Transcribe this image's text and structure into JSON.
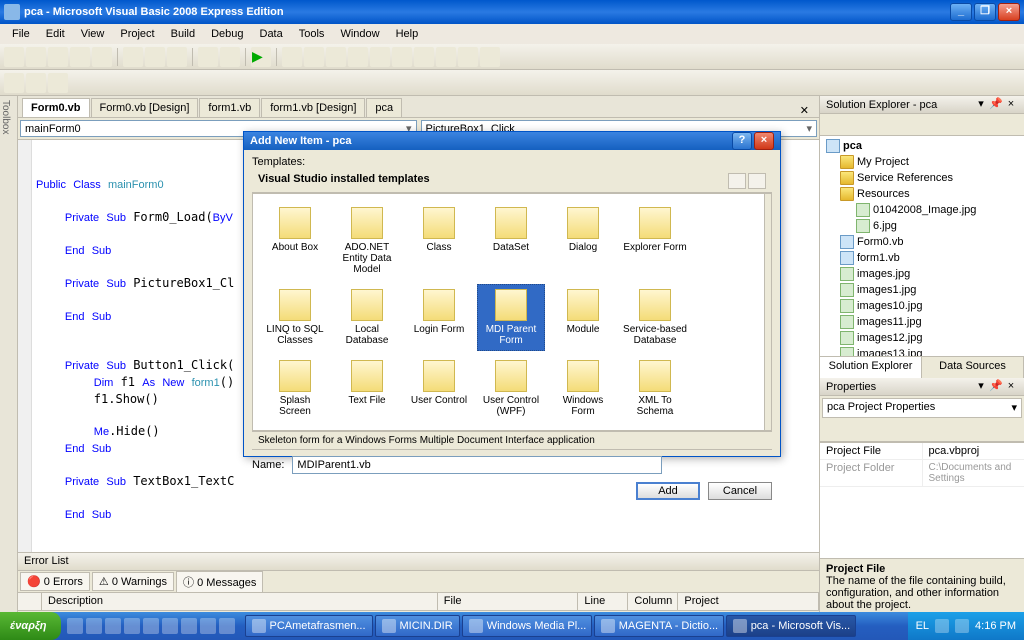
{
  "window": {
    "title": "pca - Microsoft Visual Basic 2008 Express Edition"
  },
  "menu": [
    "File",
    "Edit",
    "View",
    "Project",
    "Build",
    "Debug",
    "Data",
    "Tools",
    "Window",
    "Help"
  ],
  "tabs": [
    {
      "label": "Form0.vb",
      "active": true
    },
    {
      "label": "Form0.vb [Design]",
      "active": false
    },
    {
      "label": "form1.vb",
      "active": false
    },
    {
      "label": "form1.vb [Design]",
      "active": false
    },
    {
      "label": "pca",
      "active": false
    }
  ],
  "combo": {
    "left": "mainForm0",
    "right": "PictureBox1_Click"
  },
  "code": "Public Class mainForm0\n\n    Private Sub Form0_Load(ByV\n\n    End Sub\n\n    Private Sub PictureBox1_Cl\n\n    End Sub\n\n\n    Private Sub Button1_Click(\n        Dim f1 As New form1()\n        f1.Show()\n\n        Me.Hide()\n    End Sub\n\n    Private Sub TextBox1_TextC\n\n    End Sub",
  "error": {
    "title": "Error List",
    "filters": {
      "errors": "0 Errors",
      "warnings": "0 Warnings",
      "messages": "0 Messages"
    },
    "cols": [
      "",
      "Description",
      "File",
      "Line",
      "Column",
      "Project"
    ]
  },
  "solution": {
    "title": "Solution Explorer - pca",
    "root": "pca",
    "nodes": [
      {
        "label": "My Project",
        "icon": "folder",
        "ind": 1
      },
      {
        "label": "Service References",
        "icon": "folder",
        "ind": 1
      },
      {
        "label": "Resources",
        "icon": "folder",
        "ind": 1
      },
      {
        "label": "01042008_Image.jpg",
        "icon": "img",
        "ind": 2
      },
      {
        "label": "6.jpg",
        "icon": "img",
        "ind": 2
      },
      {
        "label": "Form0.vb",
        "icon": "vb",
        "ind": 1
      },
      {
        "label": "form1.vb",
        "icon": "vb",
        "ind": 1
      },
      {
        "label": "images.jpg",
        "icon": "img",
        "ind": 1
      },
      {
        "label": "images1.jpg",
        "icon": "img",
        "ind": 1
      },
      {
        "label": "images10.jpg",
        "icon": "img",
        "ind": 1
      },
      {
        "label": "images11.jpg",
        "icon": "img",
        "ind": 1
      },
      {
        "label": "images12.jpg",
        "icon": "img",
        "ind": 1
      },
      {
        "label": "images13.jpg",
        "icon": "img",
        "ind": 1
      }
    ],
    "tabs": {
      "a": "Solution Explorer",
      "b": "Data Sources"
    }
  },
  "props": {
    "title": "Properties",
    "obj": "pca Project Properties",
    "rows": [
      {
        "k": "Project File",
        "v": "pca.vbproj"
      },
      {
        "k": "Project Folder",
        "v": "C:\\Documents and Settings"
      }
    ],
    "desc": {
      "title": "Project File",
      "body": "The name of the file containing build, configuration, and other information about the project."
    }
  },
  "dialog": {
    "title": "Add New Item - pca",
    "templatesLabel": "Templates:",
    "groupLabel": "Visual Studio installed templates",
    "items": [
      "About Box",
      "ADO.NET Entity Data Model",
      "Class",
      "DataSet",
      "Dialog",
      "Explorer Form",
      "LINQ to SQL Classes",
      "Local Database",
      "Login Form",
      "MDI Parent Form",
      "Module",
      "Service-based Database",
      "Splash Screen",
      "Text File",
      "User Control",
      "User Control (WPF)",
      "Windows Form",
      "XML To Schema"
    ],
    "selectedIndex": 9,
    "descText": "Skeleton form for a Windows Forms Multiple Document Interface application",
    "nameLabel": "Name:",
    "nameValue": "MDIParent1.vb",
    "add": "Add",
    "cancel": "Cancel"
  },
  "taskbar": {
    "start": "έναρξη",
    "tasks": [
      "PCAmetafrasmen...",
      "MICIN.DIR",
      "Windows Media Pl...",
      "MAGENTA - Dictio...",
      "pca - Microsoft Vis..."
    ],
    "lang": "EL",
    "time": "4:16 PM"
  }
}
